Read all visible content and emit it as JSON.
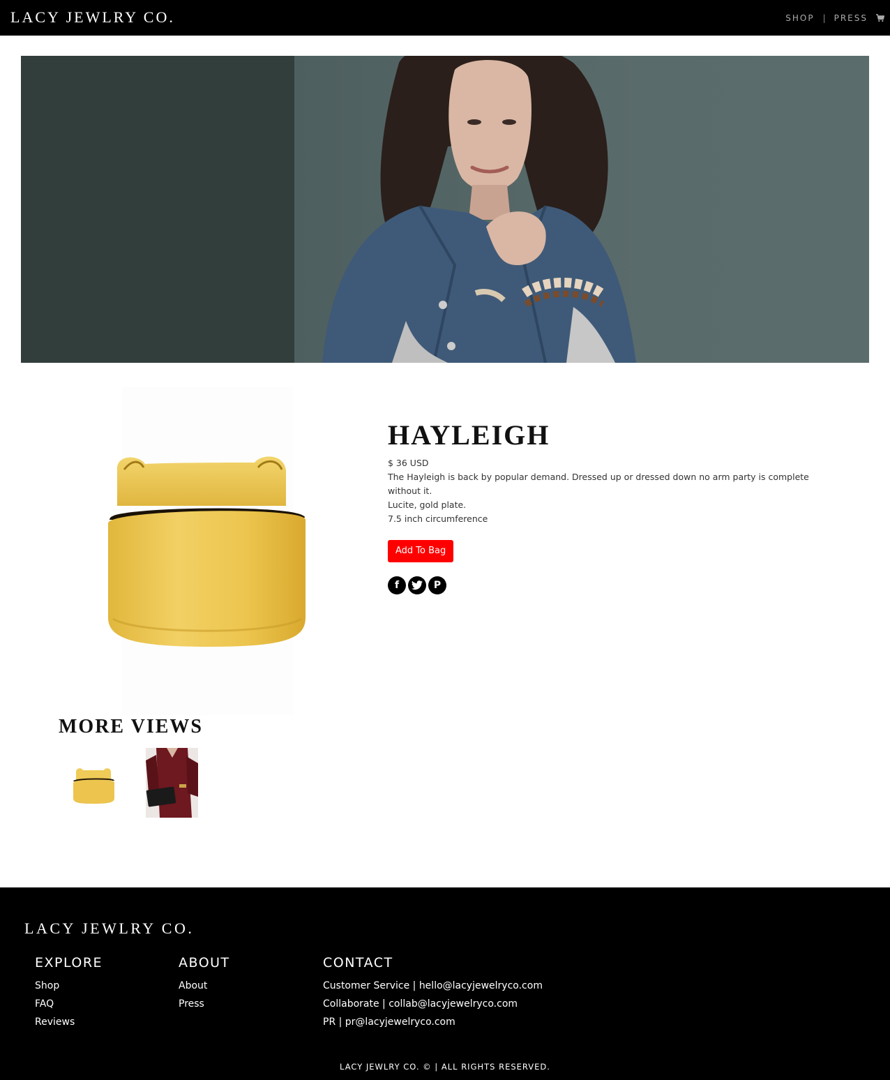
{
  "brand": {
    "name": "LACY JEWLRY CO."
  },
  "nav": {
    "shop": "SHOP",
    "separator": "|",
    "press": "PRESS",
    "cart_icon": "cart-icon"
  },
  "hero": {
    "image": "model-in-denim-jacket-wearing-bracelets"
  },
  "product": {
    "image": "gold-cuff-bracelet",
    "title": "HAYLEIGH",
    "price": "$ 36 USD",
    "description": "The Hayleigh is back by popular demand. Dressed up or dressed down no arm party is complete without it.",
    "material": "Lucite, gold plate.",
    "size": "7.5 inch circumference",
    "add_to_bag": "Add To Bag",
    "social": [
      {
        "name": "facebook-icon",
        "glyph": "f"
      },
      {
        "name": "twitter-icon",
        "glyph": "t"
      },
      {
        "name": "pinterest-icon",
        "glyph": "P"
      }
    ]
  },
  "more_views": {
    "title": "MORE VIEWS",
    "thumbs": [
      "gold-cuff-thumbnail",
      "model-burgundy-outfit-thumbnail"
    ]
  },
  "footer": {
    "brand": "LACY JEWLRY CO.",
    "explore": {
      "heading": "EXPLORE",
      "links": [
        "Shop",
        "FAQ",
        "Reviews"
      ]
    },
    "about": {
      "heading": "ABOUT",
      "links": [
        "About",
        "Press"
      ]
    },
    "contact": {
      "heading": "CONTACT",
      "lines": [
        "Customer Service | hello@lacyjewelryco.com",
        "Collaborate | collab@lacyjewelryco.com",
        "PR | pr@lacyjewelryco.com"
      ]
    },
    "copyright": "LACY JEWLRY CO. © | ALL RIGHTS RESERVED."
  },
  "colors": {
    "header_bg": "#000000",
    "accent_button": "#ff0000",
    "hero_dark": "#323e3c",
    "hero_light": "#56686a",
    "gold": "#e8c24a"
  }
}
